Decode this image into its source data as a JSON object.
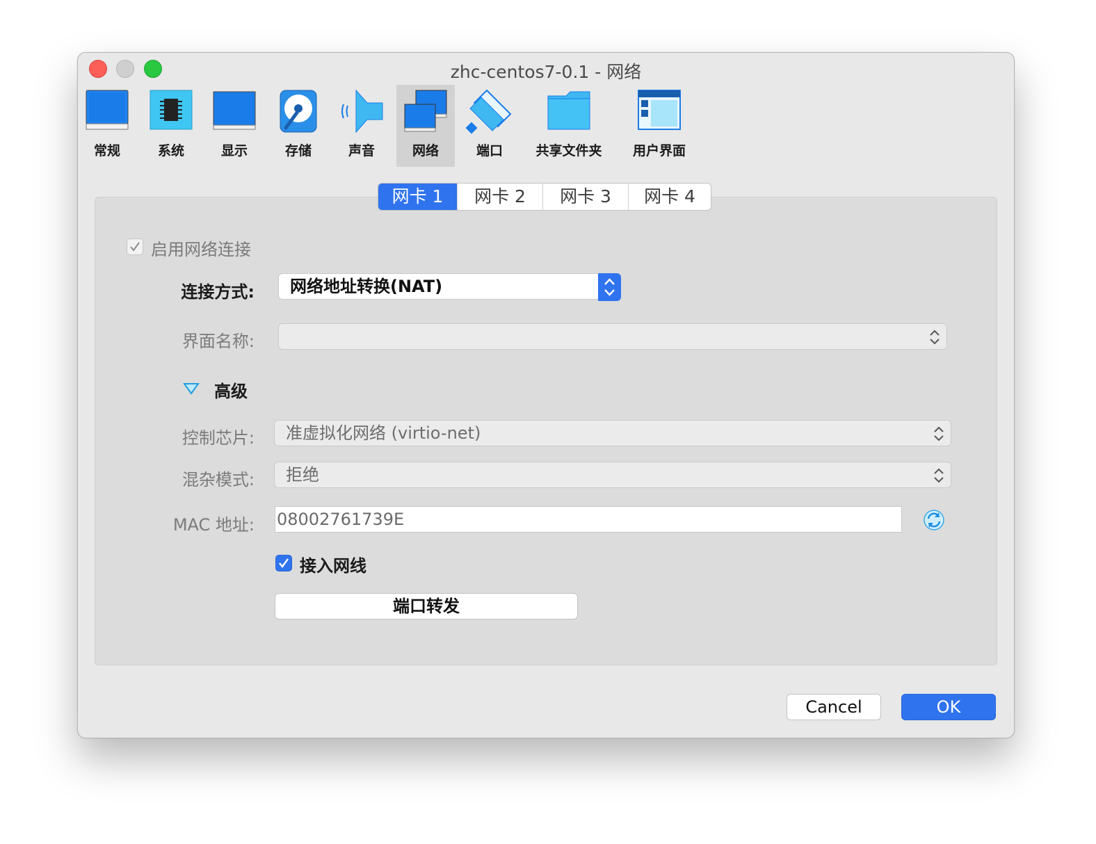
{
  "window": {
    "title": "zhc-centos7-0.1 - 网络"
  },
  "toolbar": {
    "items": [
      {
        "label": "常规",
        "icon": "general-icon"
      },
      {
        "label": "系统",
        "icon": "system-chip-icon"
      },
      {
        "label": "显示",
        "icon": "display-monitor-icon"
      },
      {
        "label": "存储",
        "icon": "storage-disk-icon"
      },
      {
        "label": "声音",
        "icon": "audio-speaker-icon"
      },
      {
        "label": "网络",
        "icon": "network-monitors-icon"
      },
      {
        "label": "端口",
        "icon": "port-connector-icon"
      },
      {
        "label": "共享文件夹",
        "icon": "shared-folder-icon"
      },
      {
        "label": "用户界面",
        "icon": "user-interface-icon"
      }
    ],
    "active": "网络"
  },
  "tabs": [
    "网卡 1",
    "网卡 2",
    "网卡 3",
    "网卡 4"
  ],
  "form": {
    "enable_label": "启用网络连接",
    "attached_label": "连接方式:",
    "attached_value": "网络地址转换(NAT)",
    "name_label": "界面名称:",
    "name_value": "",
    "advanced_label": "高级",
    "adapter_label": "控制芯片:",
    "adapter_value": "准虚拟化网络 (virtio-net)",
    "promisc_label": "混杂模式:",
    "promisc_value": "拒绝",
    "mac_label": "MAC 地址:",
    "mac_value": "08002761739E",
    "cable_label": "接入网线",
    "port_forward_label": "端口转发"
  },
  "buttons": {
    "cancel": "Cancel",
    "ok": "OK"
  },
  "colors": {
    "accent": "#2f73ee",
    "window_bg": "#e8e8e8",
    "panel_bg": "#dcdcdc"
  }
}
